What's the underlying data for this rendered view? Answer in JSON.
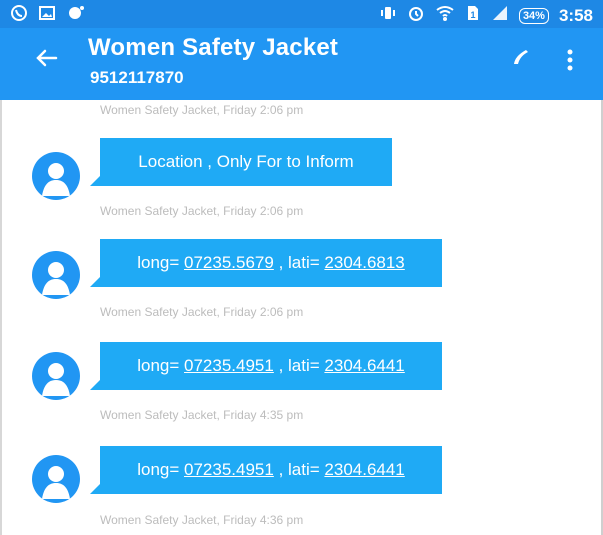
{
  "status_bar": {
    "battery": "34%",
    "time": "3:58",
    "icons_left": [
      "whatsapp-icon",
      "gallery-icon",
      "circle-dot-icon"
    ],
    "icons_right": [
      "vibration-icon",
      "alarm-icon",
      "wifi-icon",
      "sim-icon",
      "signal-icon",
      "battery-icon"
    ]
  },
  "header": {
    "title": "Women Safety Jacket",
    "subtitle": "9512117870",
    "icons": [
      "back-arrow-icon",
      "phone-icon",
      "more-vert-icon"
    ]
  },
  "conversation": {
    "timestamps": [
      "Women Safety Jacket, Friday 2:06 pm",
      "Women Safety Jacket, Friday 2:06 pm",
      "Women Safety Jacket, Friday 2:06 pm",
      "Women Safety Jacket, Friday 4:35 pm",
      "Women Safety Jacket, Friday 4:36 pm"
    ],
    "messages": [
      {
        "text": "Location , Only For to Inform"
      },
      {
        "prefix": "long= ",
        "long": "07235.5679",
        "mid": " , lati= ",
        "lati": "2304.6813"
      },
      {
        "prefix": "long= ",
        "long": "07235.4951",
        "mid": " , lati= ",
        "lati": "2304.6441"
      },
      {
        "prefix": "long= ",
        "long": "07235.4951",
        "mid": " , lati= ",
        "lati": "2304.6441"
      }
    ]
  },
  "colors": {
    "status_bar": "#1e88e5",
    "app_bar": "#2196f3",
    "bubble": "#1faaf5",
    "timestamp": "#bcbcbc"
  }
}
